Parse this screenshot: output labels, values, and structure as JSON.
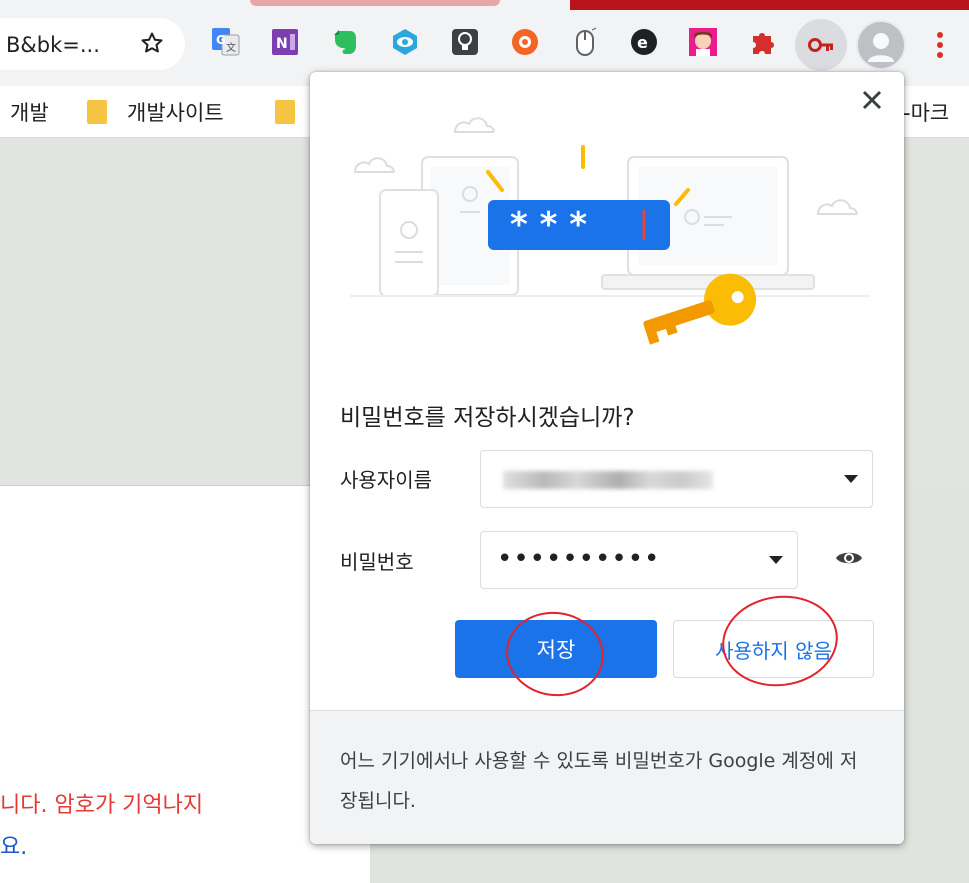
{
  "omnibox": {
    "url_text": "B&bk=..."
  },
  "extensions": [
    {
      "name": "google-translate-icon"
    },
    {
      "name": "onenote-icon"
    },
    {
      "name": "evernote-icon"
    },
    {
      "name": "eye-extension-icon"
    },
    {
      "name": "lightbulb-extension-icon"
    },
    {
      "name": "lifebuoy-extension-icon"
    },
    {
      "name": "mouse-extension-icon"
    },
    {
      "name": "e-extension-icon"
    },
    {
      "name": "avatar-extension-icon"
    },
    {
      "name": "puzzle-extension-icon"
    }
  ],
  "bookmarks": {
    "item1": "개발",
    "item2": "개발사이트",
    "item3": "-마크"
  },
  "page": {
    "line1": "니다. 암호가 기억나지",
    "line2": "요."
  },
  "popup": {
    "title": "비밀번호를 저장하시겠습니까?",
    "username_label": "사용자이름",
    "password_label": "비밀번호",
    "password_value": "••••••••••",
    "save_button": "저장",
    "never_button": "사용하지 않음",
    "footer_text": "어느 기기에서나 사용할 수 있도록 비밀번호가 Google 계정에 저장됩니다.",
    "illustration_password": "* * *"
  },
  "colors": {
    "accent": "#1a73e8",
    "annotation": "#e0242b",
    "key": "#f4b400"
  }
}
